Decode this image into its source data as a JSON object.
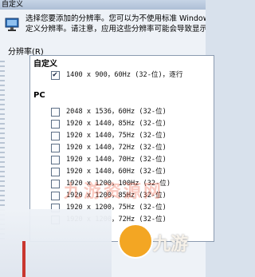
{
  "window": {
    "title": "自定义"
  },
  "dialog": {
    "description_line1": "选择您要添加的分辨率。您可以为不使用标准 Windows",
    "description_line2": "定义分辨率。请注意，应用这些分辨率可能会导致显示器"
  },
  "list": {
    "group_label": "分辨率(R)",
    "groups": [
      {
        "header": "自定义",
        "items": [
          {
            "label": "1400 x 900，60Hz (32-位)，逐行",
            "checked": true
          }
        ]
      },
      {
        "header": "PC",
        "items": [
          {
            "label": "2048 x 1536，60Hz (32-位)",
            "checked": false
          },
          {
            "label": "1920 x 1440，85Hz (32-位)",
            "checked": false
          },
          {
            "label": "1920 x 1440，75Hz (32-位)",
            "checked": false
          },
          {
            "label": "1920 x 1440，72Hz (32-位)",
            "checked": false
          },
          {
            "label": "1920 x 1440，70Hz (32-位)",
            "checked": false
          },
          {
            "label": "1920 x 1440，60Hz (32-位)",
            "checked": false
          },
          {
            "label": "1920 x 1200，100Hz (32-位)",
            "checked": false
          },
          {
            "label": "1920 x 1200，85Hz (32-位)",
            "checked": false
          },
          {
            "label": "1920 x 1200，75Hz (32-位)",
            "checked": false
          },
          {
            "label": "1920 x 1200，72Hz (32-位)",
            "checked": false
          }
        ]
      }
    ]
  },
  "watermark": {
    "text": "九游资源网"
  },
  "branding": {
    "logo_text": "九游",
    "accent_color": "#f3a623"
  }
}
